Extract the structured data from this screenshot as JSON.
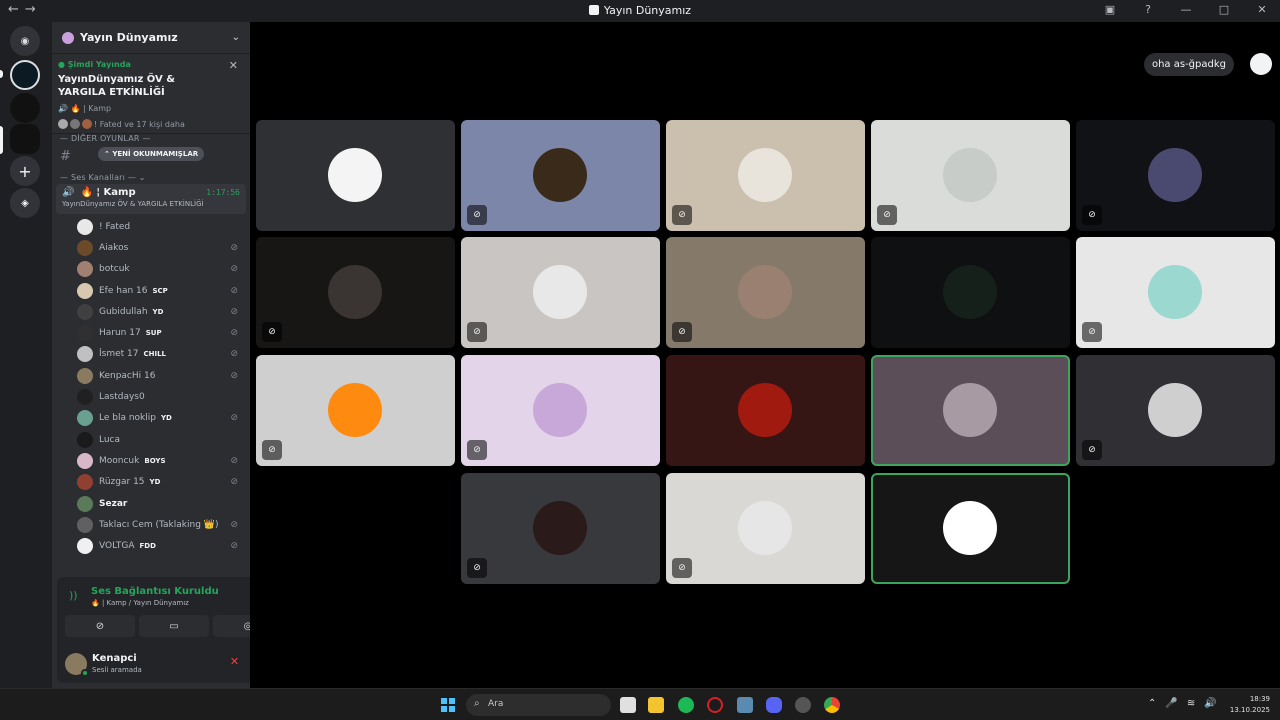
{
  "window": {
    "title": "Yayın Dünyamız",
    "nav_back": "←",
    "nav_forward": "→"
  },
  "server": {
    "name": "Yayın Dünyamız"
  },
  "live": {
    "status": "Şimdi Yayında",
    "title": "YayınDünyamız ÖV & YARGILA ETKİNLİĞİ",
    "sub": "Kamp",
    "people": "! Fated ve 17 kişi daha"
  },
  "categories": {
    "games": "— DİĞER OYUNLAR —",
    "voice": "— Ses Kanalları —"
  },
  "unread_pill": "YENİ OKUNMAMIŞLAR",
  "voice_channel": {
    "name": "Kamp",
    "timer": "1:17:56",
    "subtitle": "YayınDünyamız ÖV & YARGILA ETKİNLİĞİ"
  },
  "members": [
    {
      "name": "! Fated",
      "tag": "",
      "muted": false,
      "color": "#e8e8e8",
      "bright": false
    },
    {
      "name": "Aiakos",
      "tag": "",
      "muted": true,
      "color": "#6b4a2a",
      "bright": false
    },
    {
      "name": "botcuk",
      "tag": "",
      "muted": true,
      "color": "#a08070",
      "bright": false
    },
    {
      "name": "Efe han 16",
      "tag": "SCP",
      "muted": true,
      "color": "#d8c8b0",
      "bright": false
    },
    {
      "name": "Gubidullah",
      "tag": "YD",
      "muted": true,
      "color": "#404040",
      "bright": false
    },
    {
      "name": "Harun 17",
      "tag": "SUP",
      "muted": true,
      "color": "#303030",
      "bright": false
    },
    {
      "name": "İsmet 17",
      "tag": "CHILL",
      "muted": true,
      "color": "#c0c0c0",
      "bright": false
    },
    {
      "name": "KenpacHi 16",
      "tag": "",
      "muted": true,
      "color": "#8a7a60",
      "bright": false
    },
    {
      "name": "Lastdays0",
      "tag": "",
      "muted": false,
      "color": "#202020",
      "bright": false
    },
    {
      "name": "Le bla noklip",
      "tag": "YD",
      "muted": true,
      "color": "#6aa090",
      "bright": false
    },
    {
      "name": "Luca",
      "tag": "",
      "muted": false,
      "color": "#1a1a1a",
      "bright": false
    },
    {
      "name": "Mooncuk",
      "tag": "BOYS",
      "muted": true,
      "color": "#d8b8c8",
      "bright": false
    },
    {
      "name": "Rüzgar 15",
      "tag": "YD",
      "muted": true,
      "color": "#904030",
      "bright": false
    },
    {
      "name": "Sezar",
      "tag": "",
      "muted": false,
      "color": "#5a7a5a",
      "bright": true
    },
    {
      "name": "Taklacı Cem (Taklaking 👑)",
      "tag": "",
      "muted": true,
      "color": "#606060",
      "bright": false
    },
    {
      "name": "VOLTGA",
      "tag": "FDD",
      "muted": true,
      "color": "#f0f0f0",
      "bright": false
    }
  ],
  "rtc": {
    "status": "Ses Bağlantısı Kuruldu",
    "channel": "Kamp / Yayın Dünyamız"
  },
  "user": {
    "name": "Kenapci",
    "status": "Sesli aramada"
  },
  "speaker_label": "oha as-ğpadkg",
  "tiles": [
    {
      "bg": "#2f3033",
      "av": "#f4f4f4",
      "muted": false,
      "speaking": false
    },
    {
      "bg": "#7c86a8",
      "av": "#3a2a1a",
      "muted": true,
      "speaking": false
    },
    {
      "bg": "#cbbfae",
      "av": "#e8e4dc",
      "muted": true,
      "speaking": false
    },
    {
      "bg": "#d9dcd8",
      "av": "#c8ccc8",
      "muted": true,
      "speaking": false
    },
    {
      "bg": "#111216",
      "av": "#4a4a70",
      "muted": true,
      "speaking": false
    },
    {
      "bg": "#181614",
      "av": "#3a3532",
      "muted": true,
      "speaking": false
    },
    {
      "bg": "#c9c5c3",
      "av": "#e8e8e8",
      "muted": true,
      "speaking": false
    },
    {
      "bg": "#857a6a",
      "av": "#9a8070",
      "muted": true,
      "speaking": false
    },
    {
      "bg": "#0f1012",
      "av": "#16201a",
      "muted": false,
      "speaking": false
    },
    {
      "bg": "#e7e7e7",
      "av": "#9ad8d0",
      "muted": true,
      "speaking": false
    },
    {
      "bg": "#cfcfcf",
      "av": "#ff8a10",
      "muted": true,
      "speaking": false
    },
    {
      "bg": "#e3d4e9",
      "av": "#c8a8d8",
      "muted": true,
      "speaking": false
    },
    {
      "bg": "#361515",
      "av": "#a01a10",
      "muted": false,
      "speaking": false
    },
    {
      "bg": "#5c4e58",
      "av": "#a89aa2",
      "muted": false,
      "speaking": true
    },
    {
      "bg": "#303034",
      "av": "#cfcfcf",
      "muted": true,
      "speaking": false
    },
    {
      "bg": "#38393d",
      "av": "#2a1a1a",
      "muted": true,
      "speaking": false
    },
    {
      "bg": "#d9d8d5",
      "av": "#e6e6e6",
      "muted": true,
      "speaking": false
    },
    {
      "bg": "#161616",
      "av": "#ffffff",
      "muted": false,
      "speaking": true
    }
  ],
  "taskbar": {
    "search": "Ara",
    "time": "18:39",
    "date": "13.10.2025"
  },
  "colors": {
    "green": "#23a55a",
    "blurple": "#5865f2",
    "sidebar": "#2b2d31",
    "rail": "#1e1f22"
  }
}
